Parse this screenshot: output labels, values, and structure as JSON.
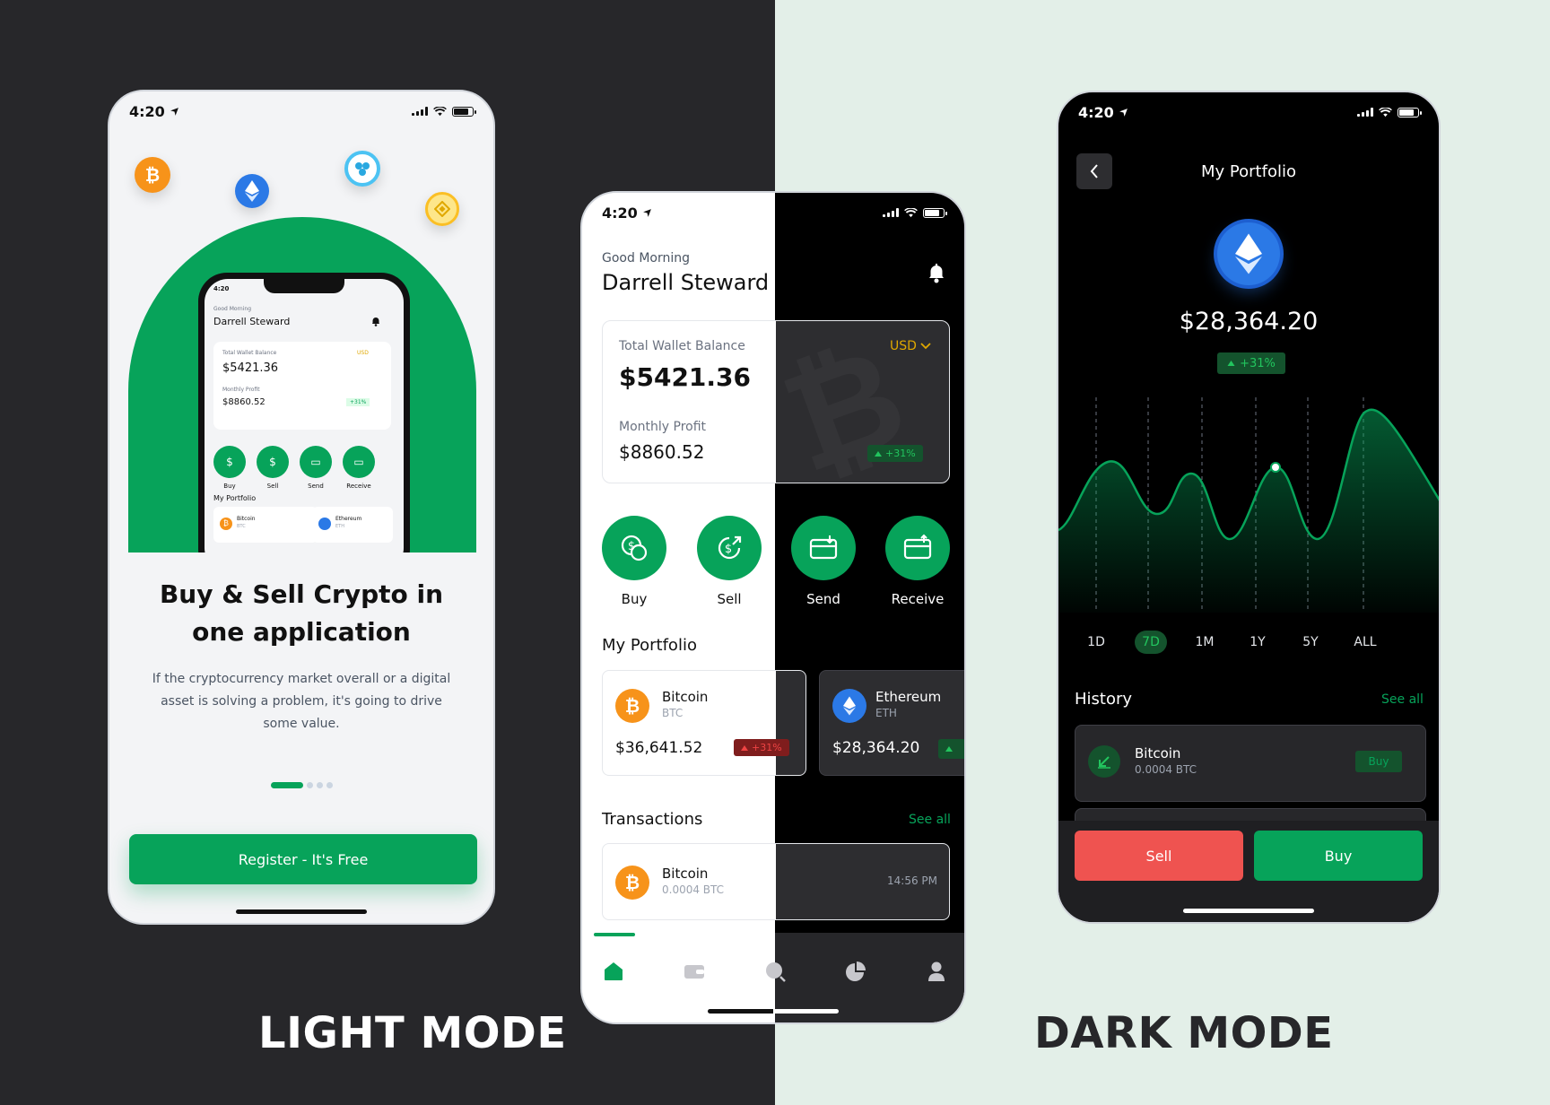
{
  "status": {
    "time": "4:20"
  },
  "light_mode": {
    "label": "LIGHT MODE",
    "onboarding": {
      "floating_coins": [
        "bitcoin-icon",
        "ethereum-icon",
        "ripple-icon",
        "binance-icon"
      ],
      "mini": {
        "time": "4:20",
        "greeting": "Good Morning",
        "name": "Darrell Steward",
        "balance_label": "Total Wallet Balance",
        "currency": "USD",
        "balance": "$5421.36",
        "profit_label": "Monthly Profit",
        "profit": "$8860.52",
        "profit_change": "+31%",
        "actions": [
          "Buy",
          "Sell",
          "Send",
          "Receive"
        ],
        "portfolio_title": "My Portfolio",
        "portfolio": [
          {
            "name": "Bitcoin",
            "symbol": "BTC"
          },
          {
            "name": "Ethereum",
            "symbol": "ETH"
          }
        ]
      },
      "headline_line1": "Buy & Sell Crypto in",
      "headline_line2": "one application",
      "description": "If the cryptocurrency market overall or a digital asset is solving a problem, it's going to drive some value.",
      "pager": {
        "pages": 4,
        "active": 1
      },
      "register_label": "Register - It's Free"
    }
  },
  "home": {
    "greeting": "Good Morning",
    "name": "Darrell Steward",
    "balance_label": "Total Wallet Balance",
    "currency": "USD",
    "balance": "$5421.36",
    "profit_label": "Monthly Profit",
    "profit": "$8860.52",
    "profit_change": "+31%",
    "actions": [
      {
        "label": "Buy",
        "icon": "buy-icon"
      },
      {
        "label": "Sell",
        "icon": "sell-icon"
      },
      {
        "label": "Send",
        "icon": "send-icon"
      },
      {
        "label": "Receive",
        "icon": "receive-icon"
      }
    ],
    "portfolio_title": "My Portfolio",
    "portfolio": [
      {
        "name": "Bitcoin",
        "symbol": "BTC",
        "value": "$36,641.52",
        "change": "+31%"
      },
      {
        "name": "Ethereum",
        "symbol": "ETH",
        "value": "$28,364.20"
      }
    ],
    "transactions_title": "Transactions",
    "see_all": "See all",
    "transactions": [
      {
        "name": "Bitcoin",
        "amount": "0.0004 BTC",
        "time": "14:56 PM"
      }
    ],
    "nav": [
      "home-icon",
      "wallet-icon",
      "search-icon",
      "pie-chart-icon",
      "profile-icon"
    ]
  },
  "dark_mode": {
    "label": "DARK MODE",
    "portfolio": {
      "title": "My Portfolio",
      "amount": "$28,364.20",
      "change": "+31%",
      "ranges": [
        "1D",
        "7D",
        "1M",
        "1Y",
        "5Y",
        "ALL"
      ],
      "selected_range": "7D",
      "history_title": "History",
      "see_all": "See all",
      "history": [
        {
          "name": "Bitcoin",
          "amount": "0.0004 BTC",
          "action": "Buy"
        }
      ],
      "sell_label": "Sell",
      "buy_label": "Buy",
      "colors": {
        "accent": "#07a35a",
        "sell": "#ef5350"
      }
    }
  }
}
